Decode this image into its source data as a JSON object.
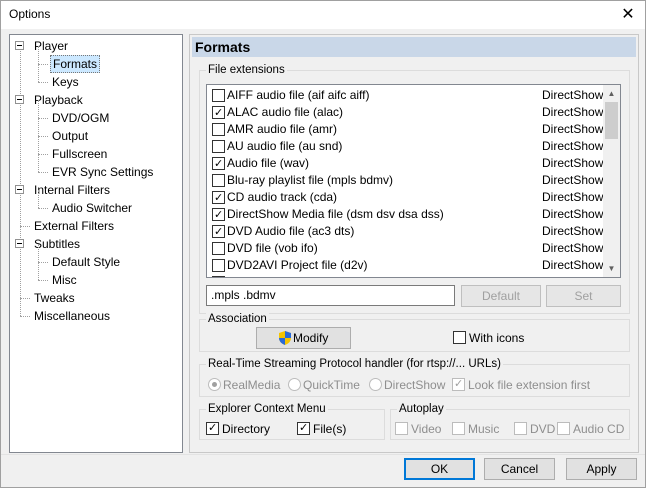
{
  "window": {
    "title": "Options",
    "close_glyph": "✕"
  },
  "tree": [
    {
      "label": "Player",
      "level": 0,
      "expander": true
    },
    {
      "label": "Formats",
      "level": 1,
      "selected": true
    },
    {
      "label": "Keys",
      "level": 1
    },
    {
      "label": "Playback",
      "level": 0,
      "expander": true
    },
    {
      "label": "DVD/OGM",
      "level": 1
    },
    {
      "label": "Output",
      "level": 1
    },
    {
      "label": "Fullscreen",
      "level": 1
    },
    {
      "label": "EVR Sync Settings",
      "level": 1
    },
    {
      "label": "Internal Filters",
      "level": 0,
      "expander": true
    },
    {
      "label": "Audio Switcher",
      "level": 1
    },
    {
      "label": "External Filters",
      "level": 0
    },
    {
      "label": "Subtitles",
      "level": 0,
      "expander": true
    },
    {
      "label": "Default Style",
      "level": 1
    },
    {
      "label": "Misc",
      "level": 1
    },
    {
      "label": "Tweaks",
      "level": 0
    },
    {
      "label": "Miscellaneous",
      "level": 0
    }
  ],
  "panel": {
    "title": "Formats"
  },
  "file_extensions": {
    "label": "File extensions",
    "rows": [
      {
        "name": "AIFF audio file (aif aifc aiff)",
        "handler": "DirectShow",
        "checked": false
      },
      {
        "name": "ALAC audio file (alac)",
        "handler": "DirectShow",
        "checked": true
      },
      {
        "name": "AMR audio file (amr)",
        "handler": "DirectShow",
        "checked": false
      },
      {
        "name": "AU audio file (au snd)",
        "handler": "DirectShow",
        "checked": false
      },
      {
        "name": "Audio file (wav)",
        "handler": "DirectShow",
        "checked": true
      },
      {
        "name": "Blu-ray playlist file (mpls bdmv)",
        "handler": "DirectShow",
        "checked": false
      },
      {
        "name": "CD audio track (cda)",
        "handler": "DirectShow",
        "checked": true
      },
      {
        "name": "DirectShow Media file (dsm dsv dsa dss)",
        "handler": "DirectShow",
        "checked": true
      },
      {
        "name": "DVD Audio file (ac3 dts)",
        "handler": "DirectShow",
        "checked": true
      },
      {
        "name": "DVD file (vob ifo)",
        "handler": "DirectShow",
        "checked": false
      },
      {
        "name": "DVD2AVI Project file (d2v)",
        "handler": "DirectShow",
        "checked": false
      },
      {
        "name": "",
        "handler": "",
        "checked": false
      }
    ],
    "ext_value": ".mpls .bdmv",
    "default_label": "Default",
    "set_label": "Set"
  },
  "association": {
    "label": "Association",
    "modify_label": "Modify",
    "with_icons_label": "With icons",
    "with_icons_checked": false
  },
  "rtsp": {
    "label": "Real-Time Streaming Protocol handler (for rtsp://... URLs)",
    "options": [
      "RealMedia",
      "QuickTime",
      "DirectShow"
    ],
    "selected": "RealMedia",
    "look_ext_label": "Look file extension first",
    "look_ext_checked": true
  },
  "explorer": {
    "label": "Explorer Context Menu",
    "directory_label": "Directory",
    "files_label": "File(s)",
    "directory_checked": true,
    "files_checked": true
  },
  "autoplay": {
    "label": "Autoplay",
    "items": [
      "Video",
      "Music",
      "DVD",
      "Audio CD"
    ]
  },
  "footer": {
    "ok_label": "OK",
    "cancel_label": "Cancel",
    "apply_label": "Apply"
  }
}
